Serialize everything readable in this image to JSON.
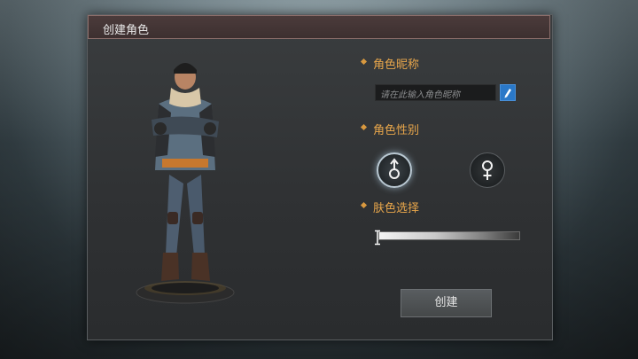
{
  "dialog": {
    "title": "创建角色"
  },
  "nickname": {
    "label": "角色昵称",
    "placeholder": "请在此输入角色昵称",
    "edit_icon": "pencil-icon"
  },
  "gender": {
    "label": "角色性别",
    "options": [
      {
        "name": "male",
        "icon": "male-symbol-icon",
        "selected": true
      },
      {
        "name": "female",
        "icon": "female-symbol-icon",
        "selected": false
      }
    ]
  },
  "skin": {
    "label": "肤色选择",
    "value": 0.0
  },
  "create_button": {
    "label": "创建"
  },
  "colors": {
    "accent": "#e8a64b",
    "edit_button": "#2a78c8",
    "panel_bg": "#2f3133",
    "title_bar": "#3d3030"
  }
}
